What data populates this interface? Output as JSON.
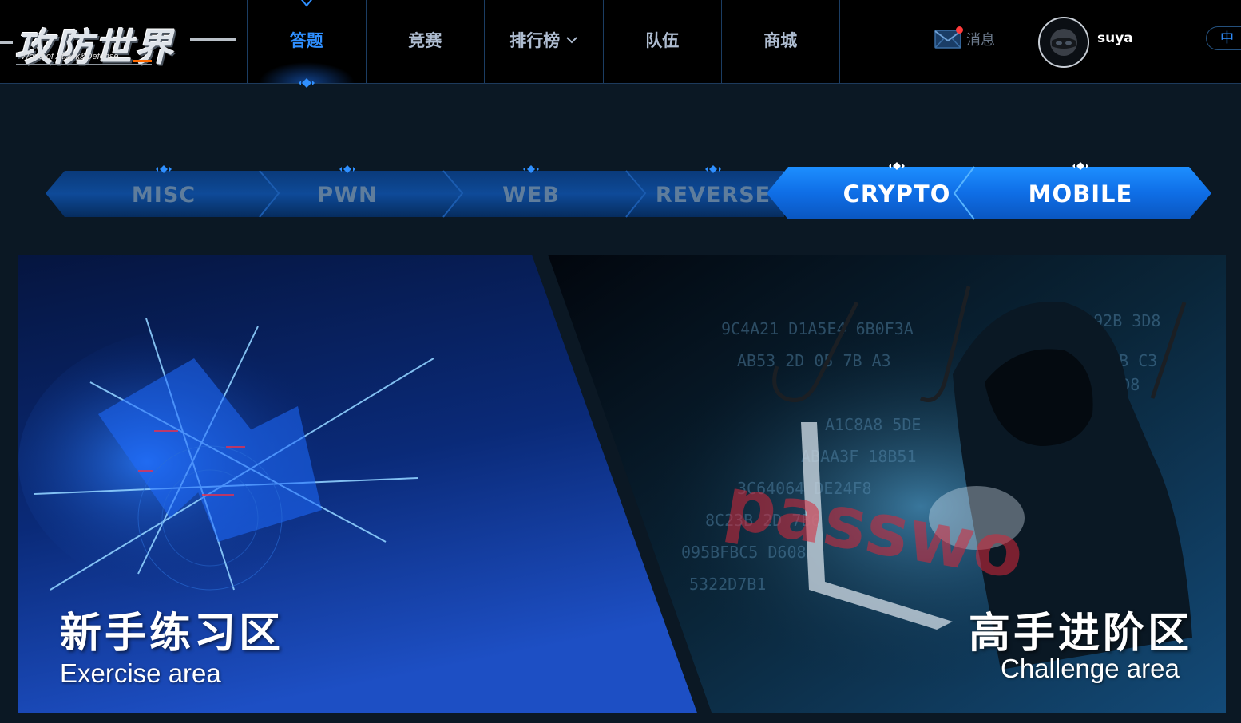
{
  "brand": {
    "title": "攻防世界",
    "subtitle": "World of Attack&Defense"
  },
  "nav": {
    "items": [
      {
        "label": "答题",
        "active": true
      },
      {
        "label": "竞赛"
      },
      {
        "label": "排行榜",
        "has_dropdown": true
      },
      {
        "label": "队伍"
      },
      {
        "label": "商城"
      }
    ]
  },
  "header": {
    "messages_label": "消息",
    "username": "suya",
    "language_label": "中"
  },
  "categories": {
    "tabs": [
      "MISC",
      "PWN",
      "WEB",
      "REVERSE",
      "CRYPTO",
      "MOBILE"
    ],
    "highlighted": [
      "CRYPTO",
      "MOBILE"
    ]
  },
  "areas": {
    "exercise": {
      "title": "新手练习区",
      "subtitle": "Exercise area"
    },
    "challenge": {
      "title": "高手进阶区",
      "subtitle": "Challenge area"
    }
  },
  "colors": {
    "accent": "#2f8fff",
    "nav_text": "#aebcd0",
    "tab_inactive_text": "#5f7d9c",
    "header_bg": "#000000",
    "page_bg": "#0b1824",
    "message_dot": "#ff3b3b"
  },
  "icons": {
    "message": "envelope-icon",
    "avatar": "ninja-mask-icon",
    "dropdown": "chevron-down-icon"
  }
}
